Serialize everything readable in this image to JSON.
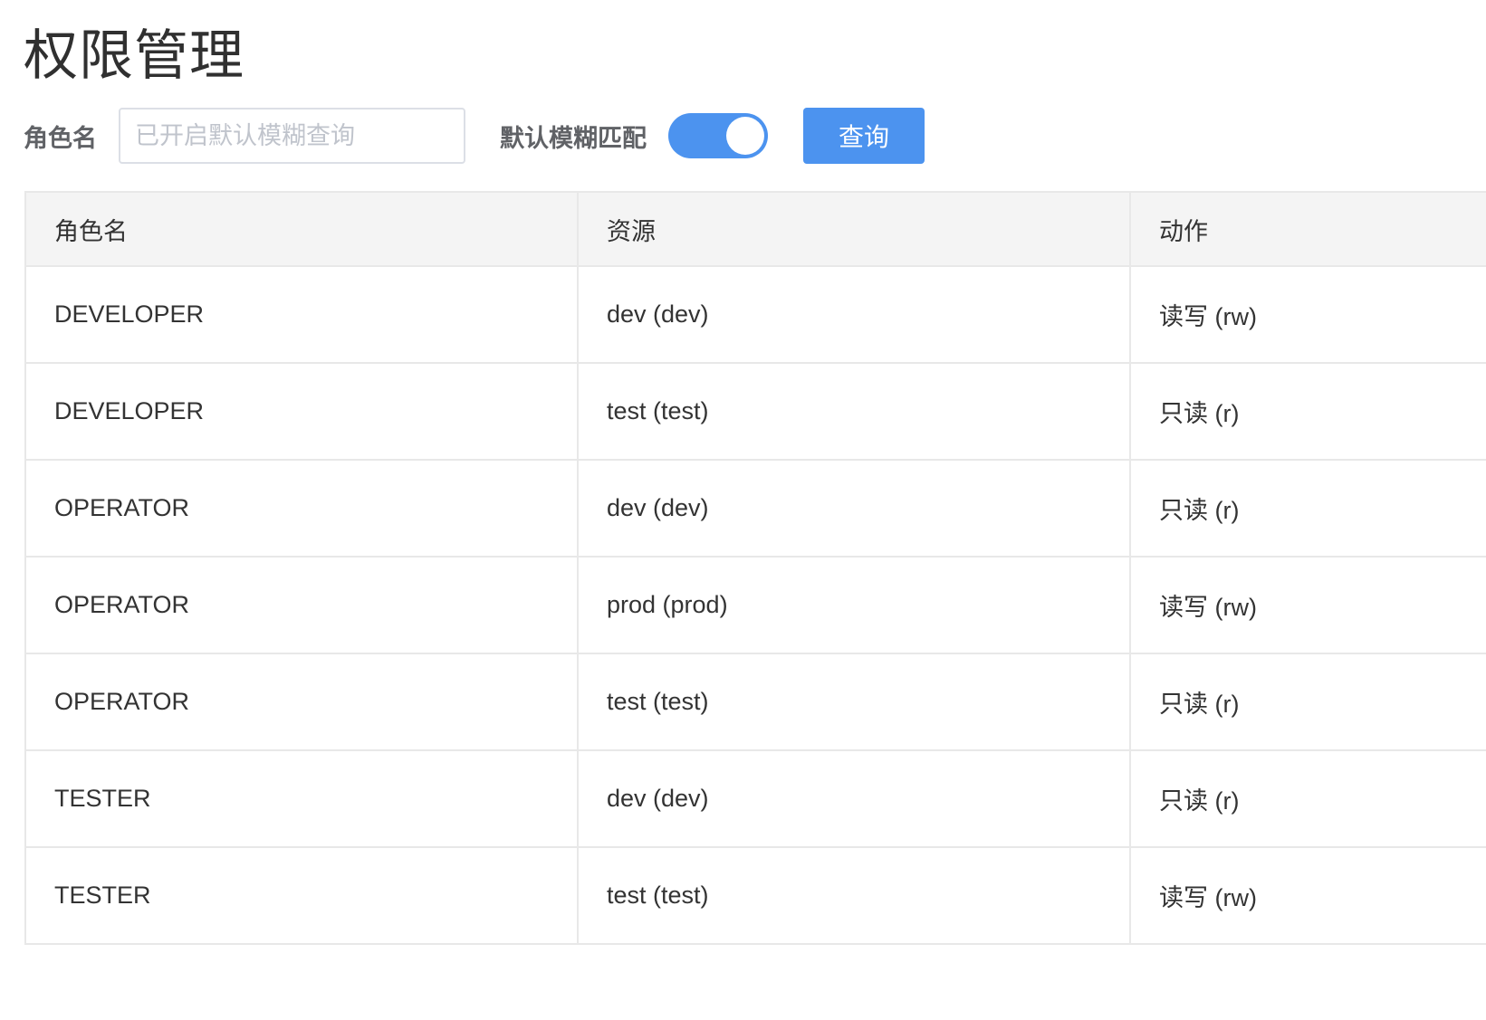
{
  "page": {
    "title": "权限管理"
  },
  "filter": {
    "role_label": "角色名",
    "search_placeholder": "已开启默认模糊查询",
    "search_value": "",
    "fuzzy_label": "默认模糊匹配",
    "fuzzy_enabled": true,
    "query_label": "查询",
    "accent_color": "#4c93ef"
  },
  "table": {
    "headers": [
      "角色名",
      "资源",
      "动作"
    ],
    "rows": [
      [
        "DEVELOPER",
        "dev (dev)",
        "读写 (rw)"
      ],
      [
        "DEVELOPER",
        "test (test)",
        "只读 (r)"
      ],
      [
        "OPERATOR",
        "dev (dev)",
        "只读 (r)"
      ],
      [
        "OPERATOR",
        "prod (prod)",
        "读写 (rw)"
      ],
      [
        "OPERATOR",
        "test (test)",
        "只读 (r)"
      ],
      [
        "TESTER",
        "dev (dev)",
        "只读 (r)"
      ],
      [
        "TESTER",
        "test (test)",
        "读写 (rw)"
      ]
    ]
  }
}
